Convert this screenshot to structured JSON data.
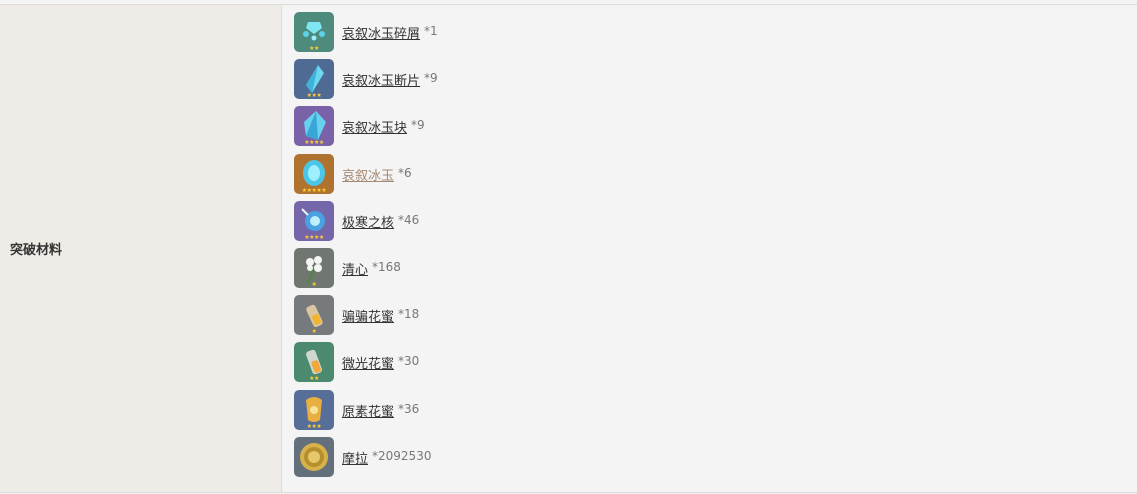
{
  "row_label": "突破材料",
  "items": [
    {
      "name": "哀叙冰玉碎屑",
      "count": "*1",
      "stars": "★★",
      "bg": "#4e8b7d",
      "icon": "ice-fragment-icon",
      "linked": true
    },
    {
      "name": "哀叙冰玉断片",
      "count": "*9",
      "stars": "★★★",
      "bg": "#4f6a93",
      "icon": "ice-shard-icon",
      "linked": true
    },
    {
      "name": "哀叙冰玉块",
      "count": "*9",
      "stars": "★★★★",
      "bg": "#7a62a8",
      "icon": "ice-chunk-icon",
      "linked": true
    },
    {
      "name": "哀叙冰玉",
      "count": "*6",
      "stars": "★★★★★",
      "bg": "#b0732f",
      "icon": "ice-gemstone-icon",
      "linked": false
    },
    {
      "name": "极寒之核",
      "count": "*46",
      "stars": "★★★★",
      "bg": "#7565a9",
      "icon": "frost-core-icon",
      "linked": true
    },
    {
      "name": "清心",
      "count": "*168",
      "stars": "★",
      "bg": "#6f7770",
      "icon": "qingxin-flower-icon",
      "linked": true
    },
    {
      "name": "骗骗花蜜",
      "count": "*18",
      "stars": "★",
      "bg": "#777a7c",
      "icon": "nectar-vial-icon",
      "linked": true
    },
    {
      "name": "微光花蜜",
      "count": "*30",
      "stars": "★★",
      "bg": "#4c8a70",
      "icon": "shimmering-nectar-icon",
      "linked": true
    },
    {
      "name": "原素花蜜",
      "count": "*36",
      "stars": "★★★",
      "bg": "#566e98",
      "icon": "energy-nectar-icon",
      "linked": true
    },
    {
      "name": "摩拉",
      "count": "*2092530",
      "stars": "",
      "bg": "#63707c",
      "icon": "mora-coin-icon",
      "linked": true
    }
  ]
}
